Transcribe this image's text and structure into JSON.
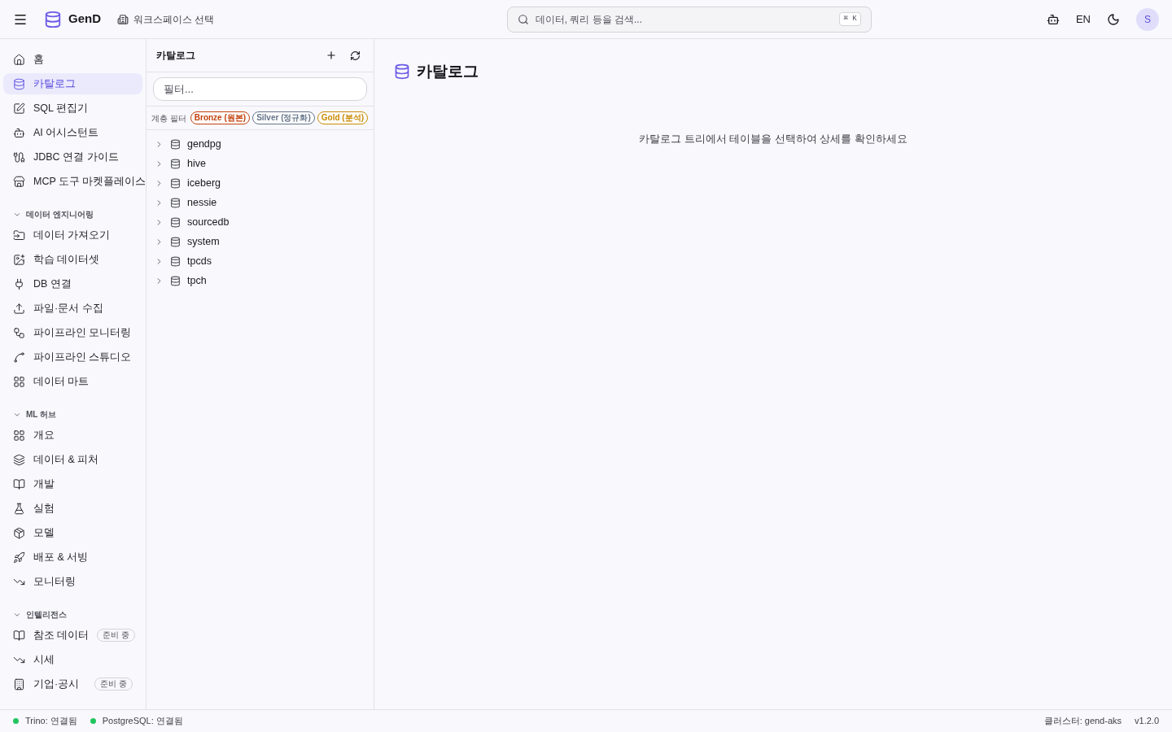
{
  "header": {
    "brand": "GenD",
    "workspace": "워크스페이스 선택",
    "search": {
      "placeholder": "데이터, 쿼리 등을 검색...",
      "shortcut": "⌘ K"
    },
    "language": "EN",
    "avatar": "S"
  },
  "sidebar": {
    "items": [
      {
        "label": "홈",
        "selected": false
      },
      {
        "label": "카탈로그",
        "selected": true
      },
      {
        "label": "SQL 편집기",
        "selected": false
      },
      {
        "label": "AI 어시스턴트",
        "selected": false
      },
      {
        "label": "JDBC 연결 가이드",
        "selected": false
      },
      {
        "label": "MCP 도구 마켓플레이스",
        "selected": false
      }
    ],
    "sections": [
      {
        "title": "데이터 엔지니어링",
        "expanded": true,
        "items": [
          {
            "label": "데이터 가져오기"
          },
          {
            "label": "학습 데이터셋"
          },
          {
            "label": "DB 연결"
          },
          {
            "label": "파일·문서 수집"
          },
          {
            "label": "파이프라인 모니터링"
          },
          {
            "label": "파이프라인 스튜디오"
          },
          {
            "label": "데이터 마트"
          }
        ]
      },
      {
        "title": "ML 허브",
        "expanded": true,
        "items": [
          {
            "label": "개요"
          },
          {
            "label": "데이터 & 피처"
          },
          {
            "label": "개발"
          },
          {
            "label": "실험"
          },
          {
            "label": "모델"
          },
          {
            "label": "배포 & 서빙"
          },
          {
            "label": "모니터링"
          }
        ]
      },
      {
        "title": "인텔리전스",
        "expanded": true,
        "items": [
          {
            "label": "참조 데이터",
            "badge": "준비 중"
          },
          {
            "label": "시세"
          },
          {
            "label": "기업·공시",
            "badge": "준비 중"
          }
        ]
      }
    ]
  },
  "catalog": {
    "title": "카탈로그",
    "filter_placeholder": "필터...",
    "tier_label": "계층 필터",
    "tiers": [
      {
        "label": "Bronze (원본)",
        "color": "#c2410c"
      },
      {
        "label": "Silver (정규화)",
        "color": "#64748b"
      },
      {
        "label": "Gold (분석)",
        "color": "#ca8a04"
      }
    ],
    "tree": [
      {
        "name": "gendpg",
        "expanded": false
      },
      {
        "name": "hive",
        "expanded": false
      },
      {
        "name": "iceberg",
        "expanded": false
      },
      {
        "name": "nessie",
        "expanded": false
      },
      {
        "name": "sourcedb",
        "expanded": false
      },
      {
        "name": "system",
        "expanded": false
      },
      {
        "name": "tpcds",
        "expanded": false
      },
      {
        "name": "tpch",
        "expanded": false
      }
    ]
  },
  "main": {
    "title": "카탈로그",
    "empty_message": "카탈로그 트리에서 테이블을 선택하여 상세를 확인하세요"
  },
  "status_bar": {
    "services": [
      {
        "label": "Trino: 연결됨",
        "color": "#22c55e"
      },
      {
        "label": "PostgreSQL: 연결됨",
        "color": "#22c55e"
      }
    ],
    "cluster": "클러스터: gend-aks",
    "version": "v1.2.0"
  }
}
